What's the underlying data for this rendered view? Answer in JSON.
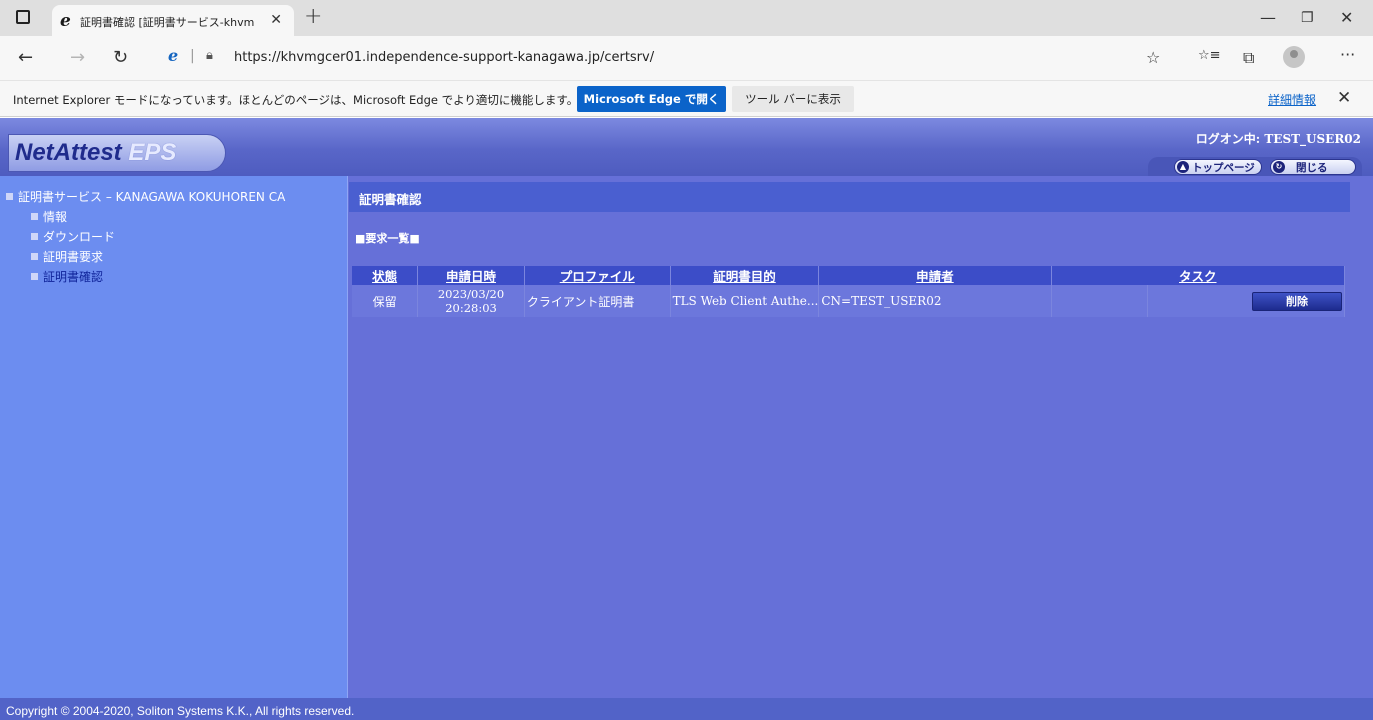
{
  "browser": {
    "tab_title": "証明書確認 [証明書サービス-khvm",
    "tab_close": "✕",
    "new_tab": "+",
    "url": "https://khvmgcer01.independence-support-kanagawa.jp/certsrv/",
    "window_controls": {
      "minimize": "—",
      "restore": "❐",
      "close": "✕"
    },
    "nav": {
      "back": "←",
      "forward": "→",
      "refresh": "↻"
    },
    "toolbar_icons": {
      "favorite_add": "☆",
      "favorites": "☆≡",
      "collections": "⧉",
      "more": "···"
    }
  },
  "ie_bar": {
    "message": "Internet Explorer モードになっています。ほとんどのページは、Microsoft Edge でより適切に機能します。",
    "open_edge": "Microsoft Edge で開く",
    "show_toolbar": "ツール バーに表示",
    "details": "詳細情報",
    "close": "✕"
  },
  "header": {
    "logo_part1": "NetAttest",
    "logo_part2": "EPS",
    "logon": "ログオン中: TEST_USER02",
    "nav_top": "トップページ",
    "nav_close": "閉じる"
  },
  "sidebar": {
    "root": "証明書サービス – KANAGAWA KOKUHOREN CA",
    "items": [
      {
        "label": "情報"
      },
      {
        "label": "ダウンロード"
      },
      {
        "label": "証明書要求"
      },
      {
        "label": "証明書確認"
      }
    ]
  },
  "main": {
    "heading": "証明書確認",
    "section_title": "■要求一覧■",
    "table": {
      "headers": [
        "状態",
        "申請日時",
        "プロファイル",
        "証明書目的",
        "申請者",
        "タスク"
      ],
      "rows": [
        {
          "status": "保留",
          "date": "2023/03/20",
          "time": "20:28:03",
          "profile": "クライアント証明書",
          "purpose": "TLS Web Client Authe...",
          "applicant": "CN=TEST_USER02",
          "task": "削除"
        }
      ]
    }
  },
  "footer": {
    "copyright": "Copyright © 2004-2020, Soliton Systems K.K., All rights reserved."
  },
  "colors": {
    "page_bg": "#6670d8",
    "sidebar_bg": "#6c8df0",
    "table_header": "#3c4dc8",
    "edge_button": "#0b63c9"
  }
}
